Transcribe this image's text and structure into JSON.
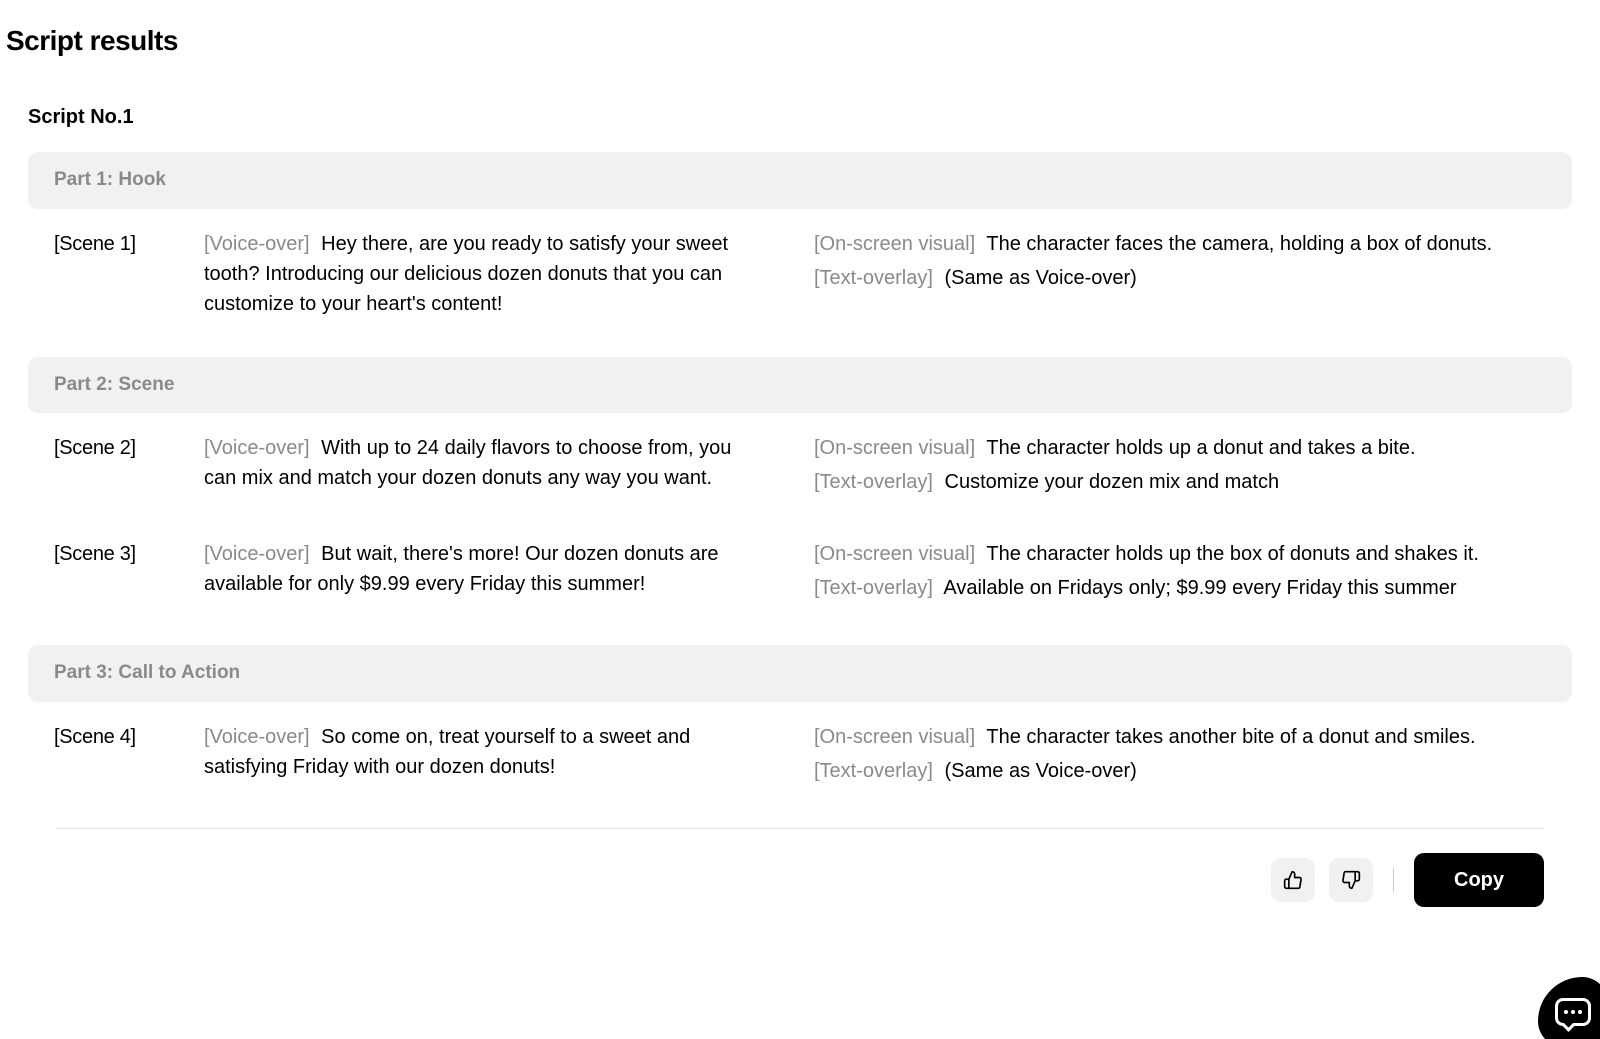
{
  "page_title": "Script results",
  "script_title": "Script No.1",
  "labels": {
    "voice_over": "[Voice-over]",
    "on_screen": "[On-screen visual]",
    "text_overlay": "[Text-overlay]"
  },
  "parts": [
    {
      "header": "Part 1: Hook",
      "scenes": [
        {
          "label": "[Scene 1]",
          "voice_over": "Hey there, are you ready to satisfy your sweet tooth? Introducing our delicious dozen donuts that you can customize to your heart's content!",
          "on_screen": "The character faces the camera, holding a box of donuts.",
          "text_overlay": "(Same as Voice-over)"
        }
      ]
    },
    {
      "header": "Part 2: Scene",
      "scenes": [
        {
          "label": "[Scene 2]",
          "voice_over": "With up to 24 daily flavors to choose from, you can mix and match your dozen donuts any way you want.",
          "on_screen": "The character holds up a donut and takes a bite.",
          "text_overlay": "Customize your dozen mix and match"
        },
        {
          "label": "[Scene 3]",
          "voice_over": "But wait, there's more! Our dozen donuts are available for only $9.99 every Friday this summer!",
          "on_screen": "The character holds up the box of donuts and shakes it.",
          "text_overlay": "Available on Fridays only; $9.99 every Friday this summer"
        }
      ]
    },
    {
      "header": "Part 3: Call to Action",
      "scenes": [
        {
          "label": "[Scene 4]",
          "voice_over": "So come on, treat yourself to a sweet and satisfying Friday with our dozen donuts!",
          "on_screen": "The character takes another bite of a donut and smiles.",
          "text_overlay": "(Same as Voice-over)"
        }
      ]
    }
  ],
  "footer": {
    "copy": "Copy"
  }
}
